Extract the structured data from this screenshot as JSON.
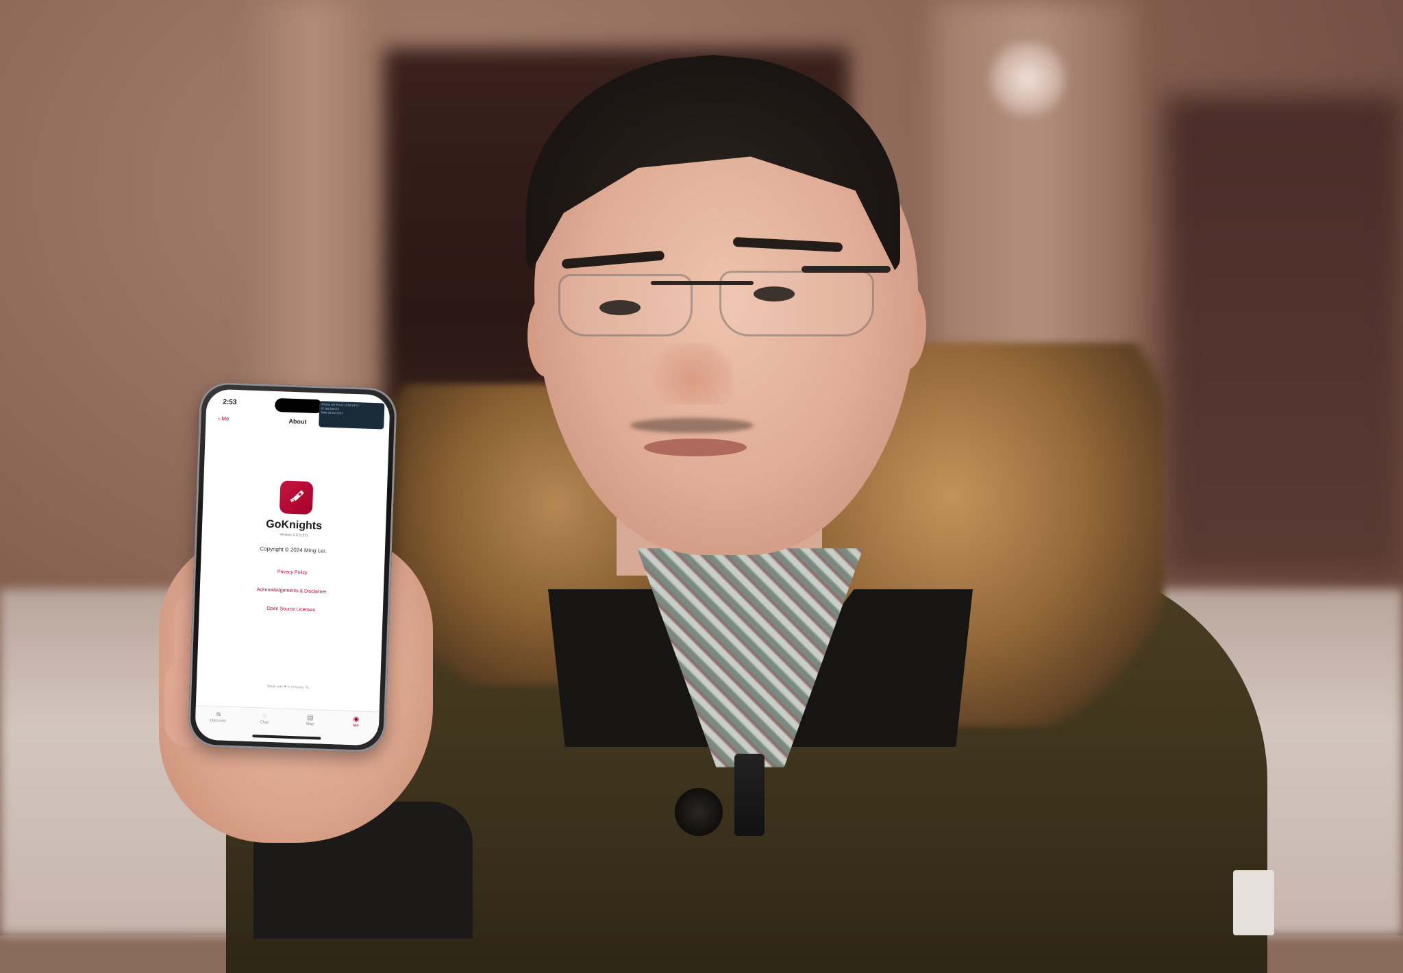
{
  "phone": {
    "status_time": "2:53",
    "overlay_lines": [
      "iPhone 16T Pro 0, 12:59 UTC+",
      "IP  192.168.0.1 ",
      "RAM  28.4%  CPU"
    ],
    "nav_back_label": "Me",
    "nav_title": "About",
    "app_name": "GoKnights",
    "app_version": "Version: 2.3.2 (57)",
    "copyright": "Copyright © 2024 Ming Lei.",
    "links": {
      "privacy": "Privacy Policy",
      "acknowledgements": "Acknowledgements & Disclaimer",
      "open_source": "Open Source Licenses"
    },
    "footer_note": "Made with ❤ in Orlando, FL",
    "tabs": [
      {
        "label": "Discover",
        "icon": "discover-icon"
      },
      {
        "label": "Chat",
        "icon": "chat-icon"
      },
      {
        "label": "Map",
        "icon": "map-icon"
      },
      {
        "label": "Me",
        "icon": "person-icon"
      }
    ],
    "accent_color": "#b00033"
  }
}
